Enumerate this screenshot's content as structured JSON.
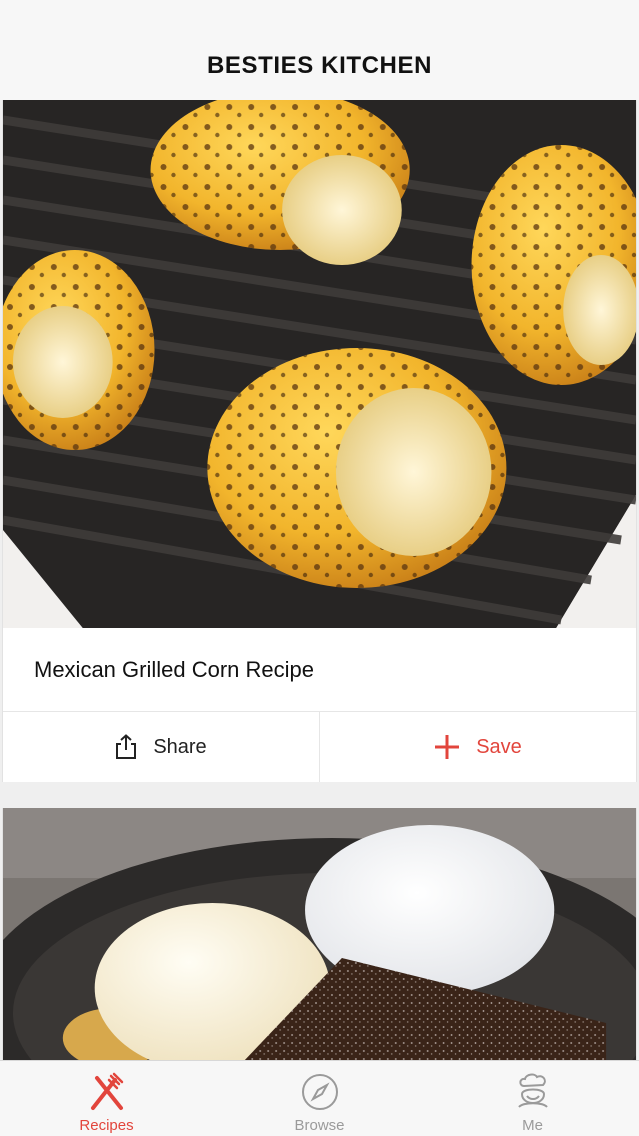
{
  "header": {
    "title": "BESTIES KITCHEN"
  },
  "feed": {
    "cards": [
      {
        "title": "Mexican Grilled Corn Recipe",
        "image_icon": "grilled-corn-photo",
        "share_label": "Share",
        "save_label": "Save"
      },
      {
        "image_icon": "brownie-ice-cream-photo"
      }
    ]
  },
  "tab_bar": {
    "items": [
      {
        "label": "Recipes",
        "icon": "fork-knife-icon",
        "active": true
      },
      {
        "label": "Browse",
        "icon": "compass-icon",
        "active": false
      },
      {
        "label": "Me",
        "icon": "chef-hat-icon",
        "active": false
      }
    ]
  },
  "colors": {
    "accent": "#e2453c",
    "background": "#efefef",
    "tab_inactive": "#9a9a9a"
  }
}
